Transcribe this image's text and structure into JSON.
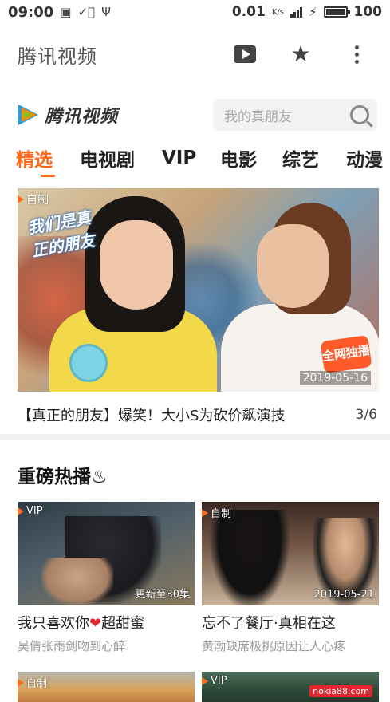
{
  "status_bar": {
    "time": "09:00",
    "network_speed": "0.01",
    "network_unit": "K/s",
    "network_type": "4G",
    "battery": "100",
    "left_icons": [
      "image-icon",
      "check-circle-icon",
      "usb-icon"
    ]
  },
  "toolbar": {
    "title": "腾讯视频",
    "buttons": [
      "play-video-icon",
      "star-icon",
      "more-icon"
    ]
  },
  "site_header": {
    "logo_text": "腾讯视频",
    "search_placeholder": "我的真朋友"
  },
  "tabs": [
    {
      "label": "精选",
      "active": true
    },
    {
      "label": "电视剧",
      "active": false
    },
    {
      "label": "VIP",
      "active": false
    },
    {
      "label": "电影",
      "active": false
    },
    {
      "label": "综艺",
      "active": false
    },
    {
      "label": "动漫",
      "active": false
    }
  ],
  "banner": {
    "badge": "自制",
    "show_logo": "我们是真正的朋友",
    "exclusive_label": "全网独播",
    "date": "2019-05-16",
    "caption": "【真正的朋友】爆笑！大小S为砍价飙演技",
    "count": "3/6"
  },
  "section": {
    "title": "重磅热播♨"
  },
  "cards": [
    {
      "badge": "VIP",
      "corner": "更新至30集",
      "title_pre": "我只喜欢你",
      "title_heart": "❤",
      "title_post": "超甜蜜",
      "subtitle": "吴倩张雨剑吻到心醉"
    },
    {
      "badge": "自制",
      "corner": "2019-05-21",
      "title_pre": "忘不了餐厅·真相在这",
      "title_heart": "",
      "title_post": "",
      "subtitle": "黄渤缺席极挑原因让人心疼"
    },
    {
      "badge": "自制",
      "corner": "",
      "title_pre": "",
      "title_heart": "",
      "title_post": "",
      "subtitle": ""
    },
    {
      "badge": "VIP",
      "corner": "",
      "title_pre": "",
      "title_heart": "",
      "title_post": "",
      "subtitle": ""
    }
  ],
  "watermark": "nokia88.com",
  "colors": {
    "accent": "#ff6a1a",
    "heart": "#e0262f"
  }
}
